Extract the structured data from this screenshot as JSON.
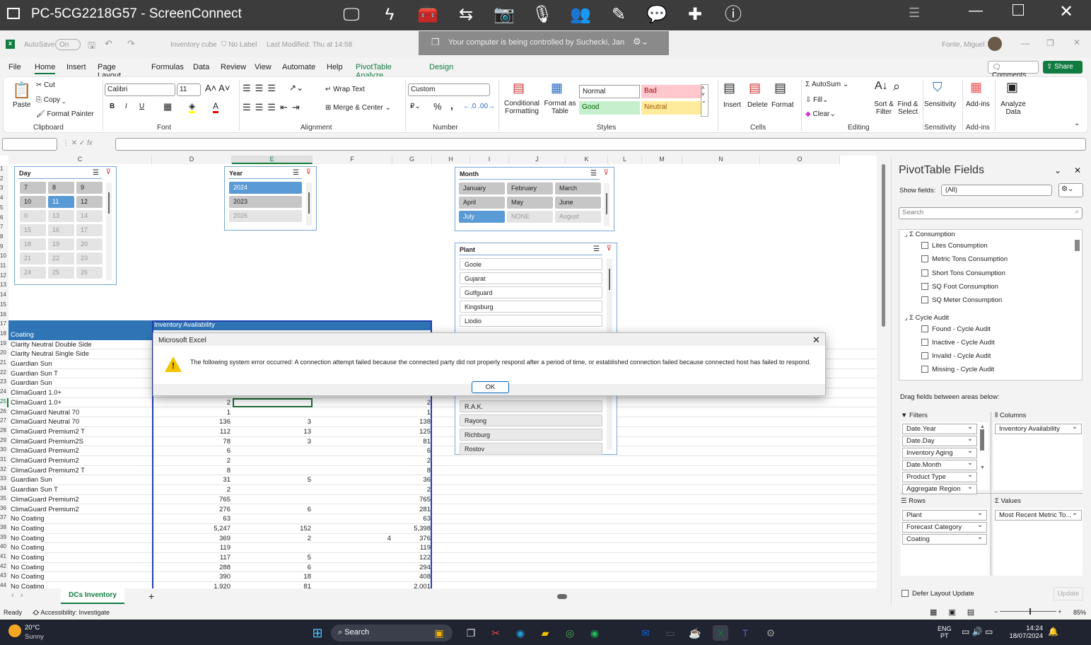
{
  "screenconnect": {
    "title": "PC-5CG2218G57 - ScreenConnect",
    "toolbar_icons": [
      "screen-icon",
      "lightning-icon",
      "toolbox-icon",
      "swap-icon",
      "camera-icon",
      "microphone-icon",
      "users-icon",
      "pen-icon",
      "chat-icon",
      "plus-icon",
      "info-icon"
    ],
    "window_icons": [
      "list-icon",
      "minimize-icon",
      "maximize-icon",
      "close-icon"
    ]
  },
  "excel": {
    "autosave": "AutoSave",
    "autosave_state": "On",
    "filename": "Inventory cube",
    "label": "No Label",
    "modified": "Last Modified: Thu at 14:58",
    "banner": "Your computer is being controlled by Suchecki, Jan",
    "user": "Fonte, Miguel"
  },
  "menu": [
    "File",
    "Home",
    "Insert",
    "Page Layout",
    "Formulas",
    "Data",
    "Review",
    "View",
    "Automate",
    "Help",
    "PivotTable Analyze",
    "Design"
  ],
  "menu_active": "Home",
  "menu_right": {
    "comments": "Comments",
    "share": "Share"
  },
  "ribbon": {
    "clipboard": {
      "paste": "Paste",
      "cut": "Cut",
      "copy": "Copy",
      "format_painter": "Format Painter",
      "label": "Clipboard"
    },
    "font": {
      "name": "Calibri",
      "size": "11",
      "bold": "B",
      "italic": "I",
      "underline": "U",
      "label": "Font"
    },
    "alignment": {
      "wrap": "Wrap Text",
      "merge": "Merge & Center",
      "label": "Alignment"
    },
    "number": {
      "format": "Custom",
      "percent": "%",
      "comma": ",",
      "label": "Number"
    },
    "styles": {
      "conditional": "Conditional Formatting",
      "format_table": "Format as Table",
      "normal": "Normal",
      "bad": "Bad",
      "good": "Good",
      "neutral": "Neutral",
      "label": "Styles"
    },
    "cells": {
      "insert": "Insert",
      "delete": "Delete",
      "format": "Format",
      "label": "Cells"
    },
    "editing": {
      "autosum": "AutoSum",
      "fill": "Fill",
      "clear": "Clear",
      "sort": "Sort & Filter",
      "find": "Find & Select",
      "label": "Editing"
    },
    "sensitivity": {
      "btn": "Sensitivity",
      "label": "Sensitivity"
    },
    "addins": {
      "btn": "Add-ins",
      "label": "Add-ins"
    },
    "analyze": {
      "btn": "Analyze Data"
    }
  },
  "formula_bar": {
    "name_box": "",
    "fx": "fx",
    "value": ""
  },
  "columns": [
    "C",
    "D",
    "E",
    "F",
    "G",
    "H",
    "I",
    "J",
    "K",
    "L",
    "M",
    "N",
    "O"
  ],
  "slicers": {
    "day": {
      "title": "Day",
      "items": [
        {
          "t": "7",
          "s": "g"
        },
        {
          "t": "8",
          "s": "g"
        },
        {
          "t": "9",
          "s": "g"
        },
        {
          "t": "10",
          "s": "g"
        },
        {
          "t": "11",
          "s": "on"
        },
        {
          "t": "12",
          "s": "g"
        },
        {
          "t": "0",
          "s": "d"
        },
        {
          "t": "13",
          "s": "d"
        },
        {
          "t": "14",
          "s": "d"
        },
        {
          "t": "15",
          "s": "d"
        },
        {
          "t": "16",
          "s": "d"
        },
        {
          "t": "17",
          "s": "d"
        },
        {
          "t": "18",
          "s": "d"
        },
        {
          "t": "19",
          "s": "d"
        },
        {
          "t": "20",
          "s": "d"
        },
        {
          "t": "21",
          "s": "d"
        },
        {
          "t": "22",
          "s": "d"
        },
        {
          "t": "23",
          "s": "d"
        },
        {
          "t": "24",
          "s": "d"
        },
        {
          "t": "25",
          "s": "d"
        },
        {
          "t": "26",
          "s": "d"
        }
      ]
    },
    "year": {
      "title": "Year",
      "items": [
        {
          "t": "2024",
          "s": "on"
        },
        {
          "t": "2023",
          "s": "g"
        },
        {
          "t": "2026",
          "s": "d"
        }
      ]
    },
    "month": {
      "title": "Month",
      "items": [
        {
          "t": "January",
          "s": "g"
        },
        {
          "t": "February",
          "s": "g"
        },
        {
          "t": "March",
          "s": "g"
        },
        {
          "t": "April",
          "s": "g"
        },
        {
          "t": "May",
          "s": "g"
        },
        {
          "t": "June",
          "s": "g"
        },
        {
          "t": "July",
          "s": "on"
        },
        {
          "t": "NONE",
          "s": "d"
        },
        {
          "t": "August",
          "s": "d"
        }
      ]
    },
    "plant": {
      "title": "Plant",
      "items_top": [
        "Goole",
        "Gujarat",
        "Gulfguard",
        "Kingsburg",
        "Llodio"
      ],
      "items_bottom": [
        "R.A.K.",
        "Rayong",
        "Richburg",
        "Rostov"
      ]
    }
  },
  "pivot": {
    "col_header": "Inventory Availability",
    "row_header": "Coating",
    "rows": [
      {
        "r": "19",
        "c": "Clarity Neutral Double Side"
      },
      {
        "r": "20",
        "c": "Clarity Neutral Single Side"
      },
      {
        "r": "21",
        "c": "Guardian Sun"
      },
      {
        "r": "22",
        "c": "Guardian Sun T"
      },
      {
        "r": "23",
        "c": "Guardian Sun"
      },
      {
        "r": "24",
        "c": "ClimaGuard 1.0+"
      },
      {
        "r": "25",
        "c": "ClimaGuard 1.0+",
        "d": "2",
        "g": "2"
      },
      {
        "r": "26",
        "c": "ClimaGuard Neutral 70",
        "d": "1",
        "g": "1"
      },
      {
        "r": "27",
        "c": "ClimaGuard Neutral 70",
        "d": "136",
        "e": "3",
        "g": "138"
      },
      {
        "r": "28",
        "c": "ClimaGuard Premium2 T",
        "d": "112",
        "e": "13",
        "g": "125"
      },
      {
        "r": "29",
        "c": "ClimaGuard Premium2S",
        "d": "78",
        "e": "3",
        "g": "81"
      },
      {
        "r": "30",
        "c": "ClimaGuard Premium2",
        "d": "6",
        "g": "6"
      },
      {
        "r": "31",
        "c": "ClimaGuard Premium2",
        "d": "2",
        "g": "2"
      },
      {
        "r": "32",
        "c": "ClimaGuard Premium2 T",
        "d": "8",
        "g": "8"
      },
      {
        "r": "33",
        "c": "Guardian Sun",
        "d": "31",
        "e": "5",
        "g": "36"
      },
      {
        "r": "34",
        "c": "Guardian Sun T",
        "d": "2",
        "g": "2"
      },
      {
        "r": "35",
        "c": "ClimaGuard Premium2",
        "d": "765",
        "g": "765"
      },
      {
        "r": "36",
        "c": "ClimaGuard Premium2",
        "d": "276",
        "e": "6",
        "g": "281"
      },
      {
        "r": "37",
        "c": "No Coating",
        "d": "63",
        "g": "63"
      },
      {
        "r": "38",
        "c": "No Coating",
        "d": "5,247",
        "e": "152",
        "g": "5,398"
      },
      {
        "r": "39",
        "c": "No Coating",
        "d": "369",
        "e": "2",
        "f": "4",
        "g": "376"
      },
      {
        "r": "40",
        "c": "No Coating",
        "d": "119",
        "g": "119"
      },
      {
        "r": "41",
        "c": "No Coating",
        "d": "117",
        "e": "5",
        "g": "122"
      },
      {
        "r": "42",
        "c": "No Coating",
        "d": "288",
        "e": "6",
        "g": "294"
      },
      {
        "r": "43",
        "c": "No Coating",
        "d": "390",
        "e": "18",
        "g": "408"
      },
      {
        "r": "44",
        "c": "No Coating",
        "d": "1,920",
        "e": "81",
        "g": "2,001"
      }
    ]
  },
  "dialog": {
    "title": "Microsoft Excel",
    "message": "The following system error occurred:  A connection attempt failed because the connected party did not properly respond after a period of time, or established connection failed because connected host has failed to respond.",
    "ok": "OK"
  },
  "pivot_fields": {
    "title": "PivotTable Fields",
    "show_fields_label": "Show fields:",
    "show_fields": "(All)",
    "search_placeholder": "Search",
    "groups": [
      {
        "name": "Consumption",
        "fields": [
          "Lites Consumption",
          "Metric Tons Consumption",
          "Short Tons Consumption",
          "SQ Foot Consumption",
          "SQ Meter Consumption"
        ]
      },
      {
        "name": "Cycle Audit",
        "fields": [
          "Found - Cycle Audit",
          "Inactive - Cycle Audit",
          "Invalid - Cycle Audit",
          "Missing - Cycle Audit"
        ]
      }
    ],
    "drag_label": "Drag fields between areas below:",
    "filters_label": "Filters",
    "filters": [
      "Date.Year",
      "Date.Day",
      "Inventory Aging",
      "Date.Month",
      "Product Type",
      "Aggregate Region"
    ],
    "columns_label": "Columns",
    "columns": [
      "Inventory Availability"
    ],
    "rows_label": "Rows",
    "rows": [
      "Plant",
      "Forecast Category",
      "Coating"
    ],
    "values_label": "Values",
    "values": [
      "Most Recent Metric To..."
    ],
    "defer": "Defer Layout Update",
    "update": "Update"
  },
  "sheet_tabs": {
    "active": "DCs Inventory",
    "add": "+"
  },
  "status": {
    "ready": "Ready",
    "accessibility": "Accessibility: Investigate",
    "zoom": "85%"
  },
  "taskbar": {
    "temp": "20°C",
    "weather": "Sunny",
    "search": "Search",
    "lang": "ENG",
    "region": "PT",
    "time": "14:24",
    "date": "18/07/2024"
  },
  "colors": {
    "accent": "#2f75b5",
    "excel_green": "#107c41",
    "slicer_selected": "#5b9bd5"
  }
}
